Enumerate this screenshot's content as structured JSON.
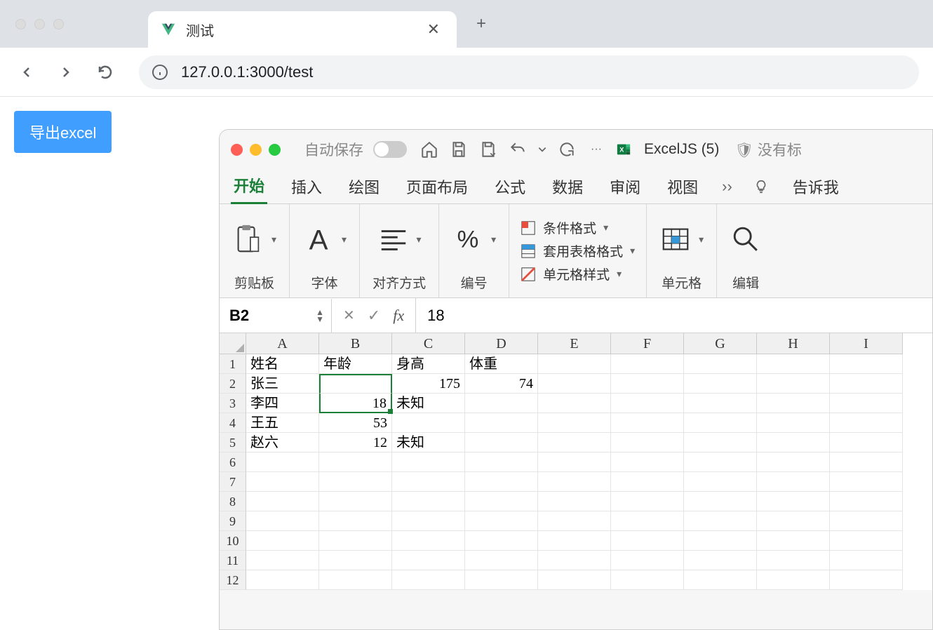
{
  "browser": {
    "tab_title": "测试",
    "url": "127.0.0.1:3000/test"
  },
  "page": {
    "export_button": "导出excel"
  },
  "excel": {
    "autosave": "自动保存",
    "doc_title": "ExcelJS (5)",
    "security": "没有标",
    "ribbon_tabs": [
      "开始",
      "插入",
      "绘图",
      "页面布局",
      "公式",
      "数据",
      "审阅",
      "视图"
    ],
    "tell_me": "告诉我",
    "groups": {
      "clipboard": "剪贴板",
      "font": "字体",
      "align": "对齐方式",
      "number": "编号",
      "cond_format": "条件格式",
      "table_format": "套用表格格式",
      "cell_styles": "单元格样式",
      "cells": "单元格",
      "editing": "编辑"
    },
    "name_box": "B2",
    "formula_value": "18",
    "columns": [
      "A",
      "B",
      "C",
      "D",
      "E",
      "F",
      "G",
      "H",
      "I"
    ],
    "row_count": 12,
    "data": {
      "header": [
        "姓名",
        "年龄",
        "身高",
        "体重"
      ],
      "rows": [
        {
          "name": "张三",
          "age": "",
          "height": "175",
          "weight": "74"
        },
        {
          "name": "李四",
          "age": "18",
          "height": "未知",
          "weight": ""
        },
        {
          "name": "王五",
          "age": "53",
          "height": "",
          "weight": ""
        },
        {
          "name": "赵六",
          "age": "12",
          "height": "未知",
          "weight": ""
        }
      ]
    },
    "selected_cell": {
      "row": 2,
      "col": "B"
    }
  }
}
